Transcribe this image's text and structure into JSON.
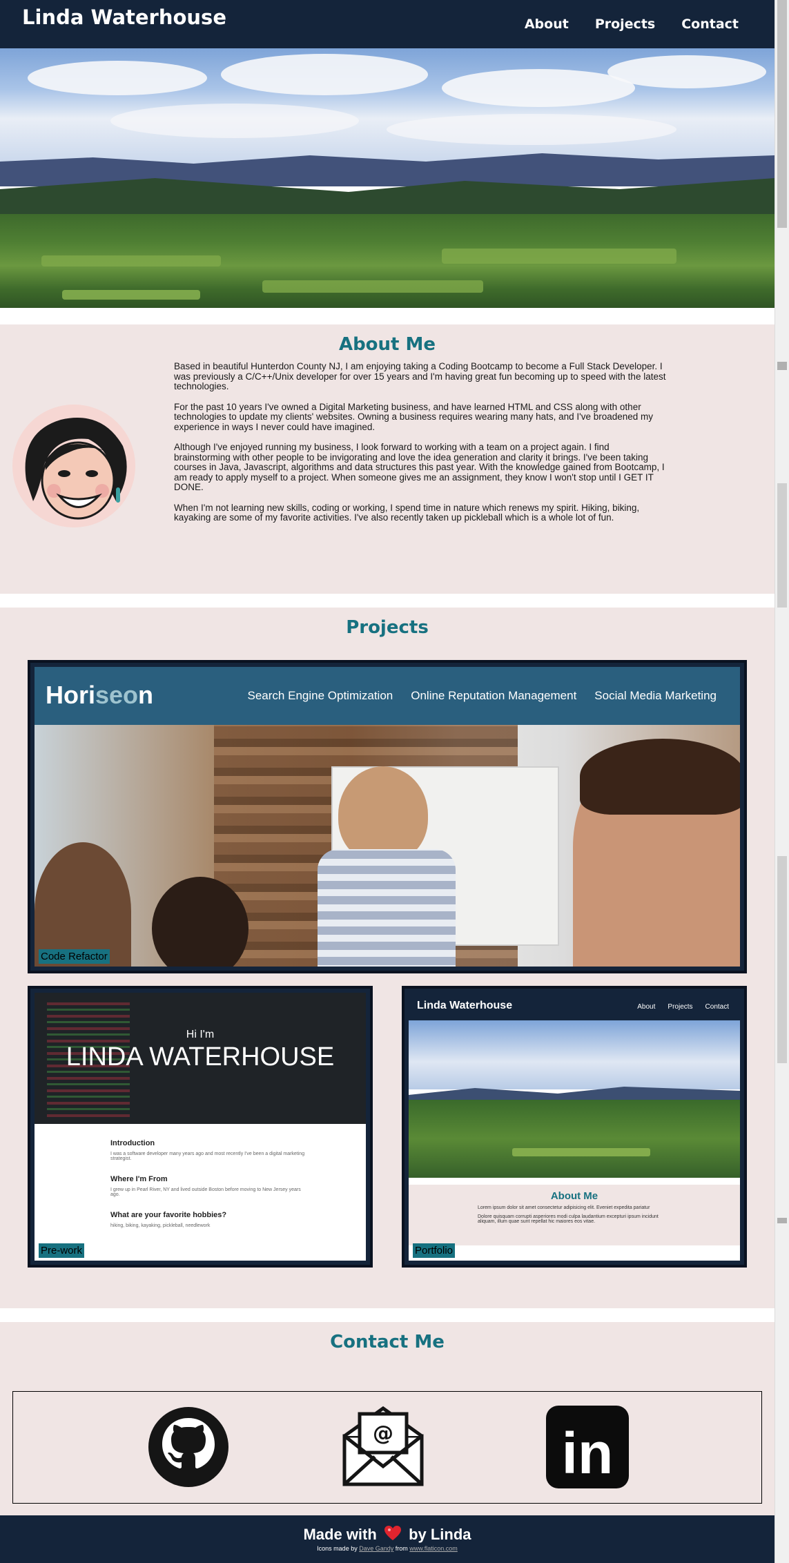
{
  "header": {
    "brand": "Linda Waterhouse",
    "nav": [
      "About",
      "Projects",
      "Contact"
    ]
  },
  "about": {
    "title": "About Me",
    "paragraphs": [
      "Based in beautiful Hunterdon County NJ, I am enjoying taking a Coding Bootcamp to become a Full Stack Developer. I was previously a C/C++/Unix developer for over 15 years and I'm having great fun becoming up to speed with the latest technologies.",
      "For the past 10 years I've owned a Digital Marketing business, and have learned HTML and CSS along with other technologies to update my clients' websites. Owning a business requires wearing many hats, and I've broadened my experience in ways I never could have imagined.",
      "Although I've enjoyed running my business, I look forward to working with a team on a project again. I find brainstorming with other people to be invigorating and love the idea generation and clarity it brings. I've been taking courses in Java, Javascript, algorithms and data structures this past year. With the knowledge gained from Bootcamp, I am ready to apply myself to a project. When someone gives me an assignment, they know I won't stop until I GET IT DONE.",
      "When I'm not learning new skills, coding or working, I spend time in nature which renews my spirit. Hiking, biking, kayaking are some of my favorite activities. I've also recently taken up pickleball which is a whole lot of fun."
    ]
  },
  "projects": {
    "title": "Projects",
    "items": [
      {
        "label": "Code Refactor",
        "logo_a": "Hori",
        "logo_b": "seo",
        "logo_c": "n",
        "nav": [
          "Search Engine Optimization",
          "Online Reputation Management",
          "Social Media Marketing"
        ]
      },
      {
        "label": "Pre-work",
        "hi": "Hi I'm",
        "name": "LINDA WATERHOUSE",
        "sections": [
          {
            "heading": "Introduction",
            "text": "I was a software developer many years ago and most recently I've been a digital marketing strategist."
          },
          {
            "heading": "Where I'm From",
            "text": "I grew up in Pearl River, NY and lived outside Boston before moving to New Jersey years ago."
          },
          {
            "heading": "What are your favorite hobbies?",
            "text": "hiking, biking, kayaking, pickleball, needlework"
          }
        ]
      },
      {
        "label": "Portfolio",
        "brand": "Linda Waterhouse",
        "nav": [
          "About",
          "Projects",
          "Contact"
        ],
        "about_title": "About Me",
        "text1": "Lorem ipsum dolor sit amet consectetur adipisicing elit. Eveniet expedita pariatur",
        "text2": "Dolore quisquam corrupti asperiores modi culpa laudantium excepturi ipsum incidunt aliquam, illum quae sunt repellat hic maiores eos vitae."
      }
    ]
  },
  "contact": {
    "title": "Contact Me",
    "email_glyph": "@",
    "linkedin_text": "in"
  },
  "footer": {
    "made_prefix": "Made with",
    "made_suffix": "by Linda",
    "credit_prefix": "Icons made by",
    "credit_author": "Dave Gandy",
    "credit_mid": "from",
    "credit_site": "www.flaticon.com"
  },
  "colors": {
    "header_bg": "#14243a",
    "accent": "#177180",
    "section_bg": "#f0e5e4",
    "heart": "#e0242e"
  }
}
